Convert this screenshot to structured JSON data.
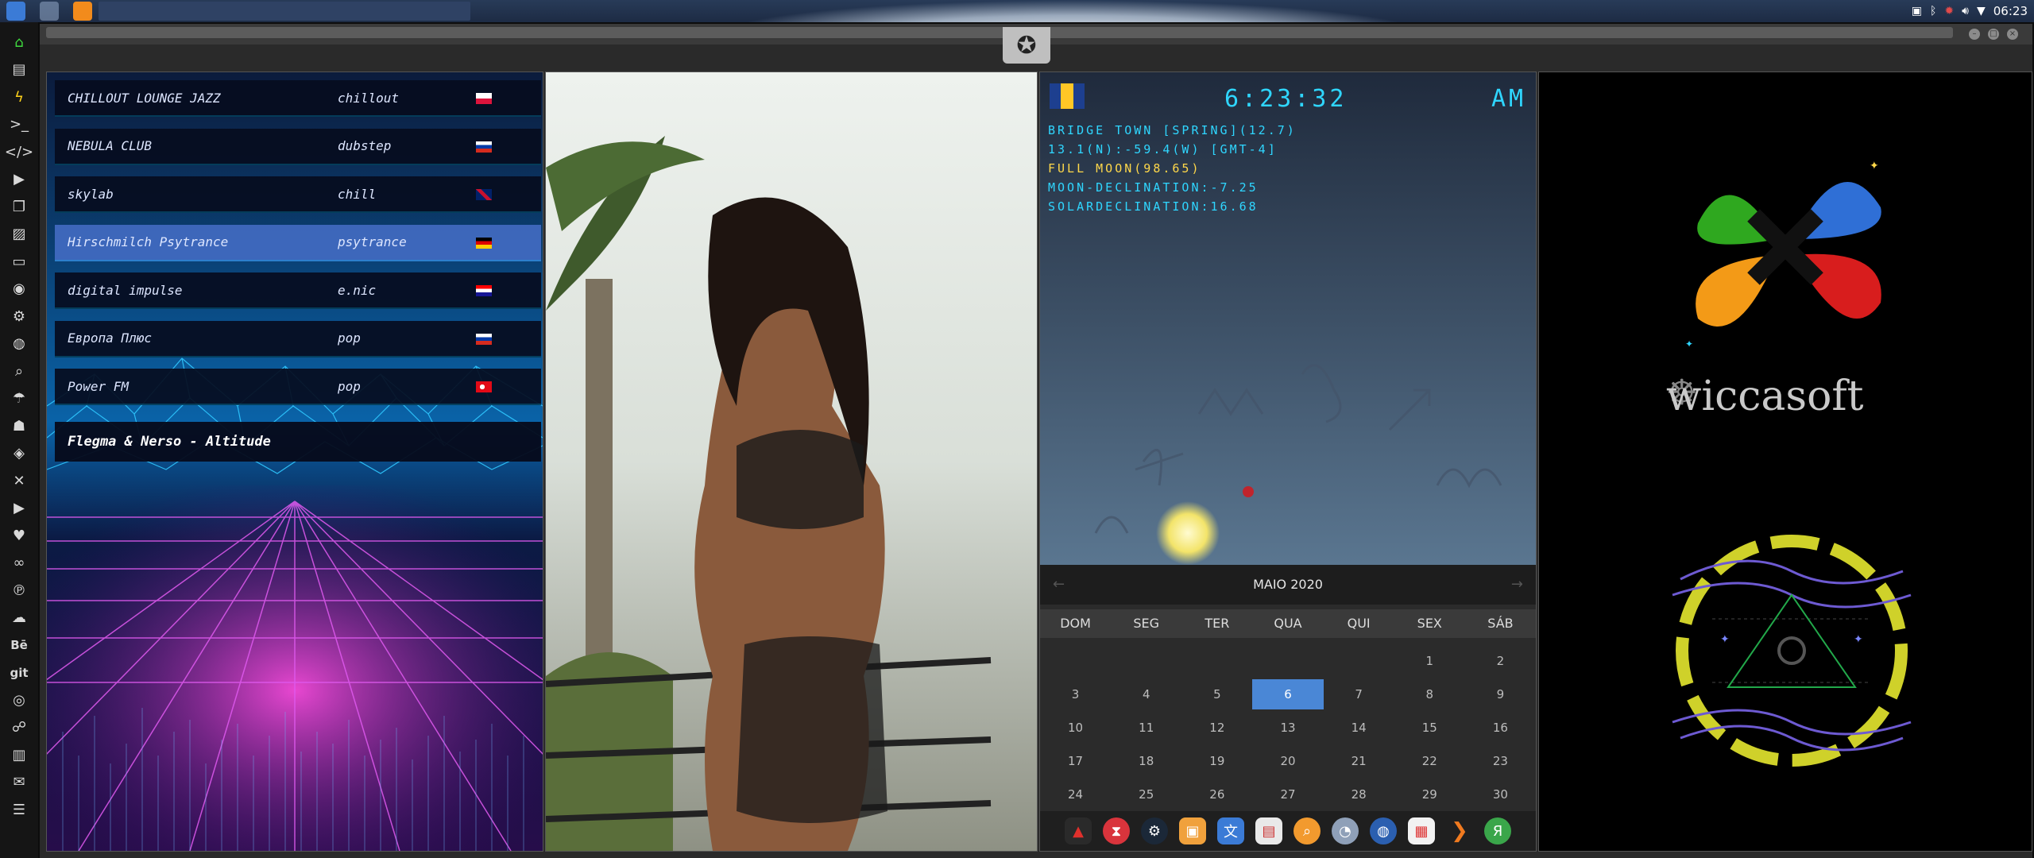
{
  "topbar": {
    "clock": "06:23",
    "launcher_icons": [
      "file-manager-icon",
      "app-icon",
      "sublime-icon"
    ],
    "tray_icons": [
      "image-icon",
      "bluetooth-icon",
      "alert-icon",
      "volume-icon",
      "wifi-icon"
    ]
  },
  "dock": {
    "icons": [
      "home-icon",
      "file-icon",
      "bolt-icon",
      "terminal-icon",
      "code-icon",
      "play-icon",
      "copy-icon",
      "image-icon",
      "id-card-icon",
      "chrome-icon",
      "gear-icon",
      "globe-icon",
      "search-icon",
      "umbrella-icon",
      "contacts-icon",
      "tag-icon",
      "tools-icon",
      "youtube-icon",
      "heart-icon",
      "infinity-icon",
      "pinterest-icon",
      "cloud-icon",
      "behance-icon",
      "git-icon",
      "github-icon",
      "group-icon",
      "map-icon",
      "mail-icon",
      "list-icon"
    ],
    "behance_label": "Bē",
    "git_label": "git"
  },
  "radio": {
    "stations": [
      {
        "name": "CHILLOUT LOUNGE JAZZ",
        "genre": "chillout",
        "flag": "pl"
      },
      {
        "name": "NEBULA CLUB",
        "genre": "dubstep",
        "flag": "ru"
      },
      {
        "name": "skylab",
        "genre": "chill",
        "flag": "gb"
      },
      {
        "name": "Hirschmilch Psytrance",
        "genre": "psytrance",
        "flag": "de"
      },
      {
        "name": "digital impulse",
        "genre": "e.nic",
        "flag": "hr"
      },
      {
        "name": "Европа Плюс",
        "genre": "pop",
        "flag": "ru"
      },
      {
        "name": "Power FM",
        "genre": "pop",
        "flag": "tr"
      }
    ],
    "now_playing": "Flegma & Nerso - Altitude"
  },
  "astro": {
    "time": "6:23:32",
    "ampm": "AM",
    "line1": "BRIDGE TOWN [SPRING](12.7)",
    "line2": "13.1(N):-59.4(W) [GMT-4]",
    "line3": "FULL MOON(98.65)",
    "line4": "MOON-DECLINATION:-7.25",
    "line5": "SOLARDECLINATION:16.68",
    "colors": {
      "cyan": "#2fd6ff",
      "yellow": "#ffd84a"
    }
  },
  "calendar": {
    "month": "MAIO 2020",
    "prev": "←",
    "next": "→",
    "weekdays": [
      "DOM",
      "SEG",
      "TER",
      "QUA",
      "QUI",
      "SEX",
      "SÁB"
    ],
    "days": [
      "",
      "",
      "",
      "",
      "",
      "1",
      "2",
      "3",
      "4",
      "5",
      "6",
      "7",
      "8",
      "9",
      "10",
      "11",
      "12",
      "13",
      "14",
      "15",
      "16",
      "17",
      "18",
      "19",
      "20",
      "21",
      "22",
      "23",
      "24",
      "25",
      "26",
      "27",
      "28",
      "29",
      "30"
    ],
    "today": "6"
  },
  "apps": [
    "acrobat-icon",
    "hourglass-icon",
    "steam-icon",
    "photos-icon",
    "translate-icon",
    "presentation-icon",
    "search-icon",
    "clock-icon",
    "globe-icon",
    "calendar-icon",
    "arrow-icon",
    "yandex-icon"
  ],
  "wicca": {
    "brand": "wiccasoft"
  }
}
